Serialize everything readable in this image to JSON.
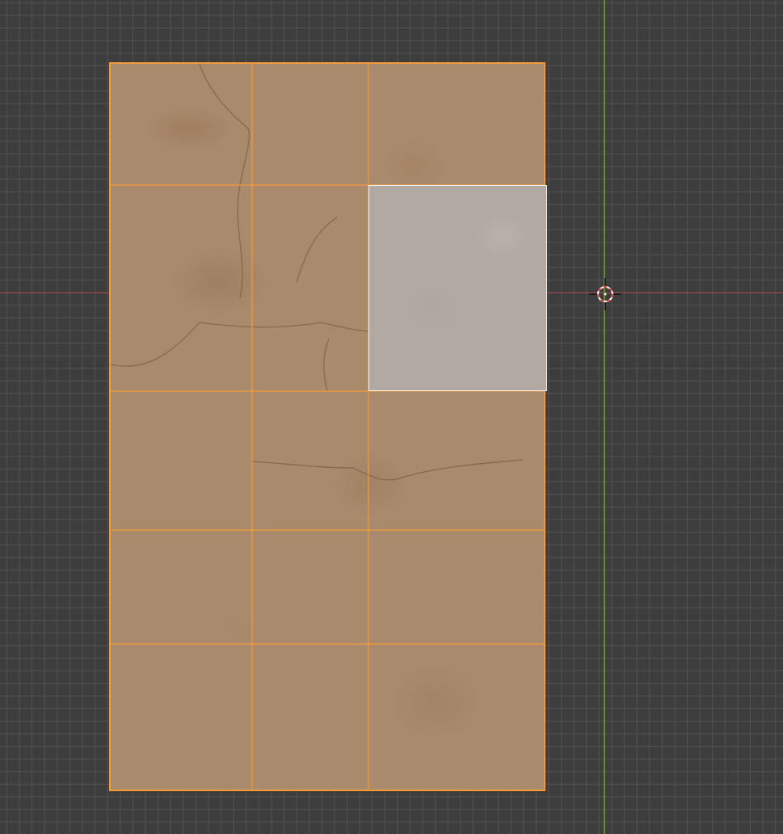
{
  "viewport": {
    "background_color": "#3d3d3d",
    "grid_color": "#555555",
    "x_axis_color": "#a54a4f",
    "y_axis_color": "#6f8a2c"
  },
  "mesh": {
    "rows": 5,
    "columns": 3,
    "edge_color": "#f39a35",
    "texture_color": "#a98a6d",
    "selected_face": {
      "row": 2,
      "column": 3,
      "outline_color": "#f2f2f2",
      "fill_color": "#b2aaa2"
    }
  },
  "icons": {
    "cursor": "3d-cursor-icon"
  }
}
